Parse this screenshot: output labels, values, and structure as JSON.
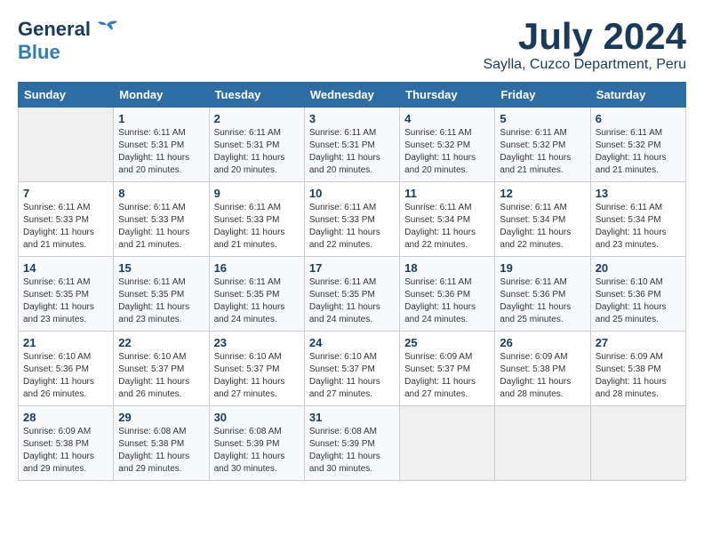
{
  "header": {
    "logo_general": "General",
    "logo_blue": "Blue",
    "month_title": "July 2024",
    "subtitle": "Saylla, Cuzco Department, Peru"
  },
  "weekdays": [
    "Sunday",
    "Monday",
    "Tuesday",
    "Wednesday",
    "Thursday",
    "Friday",
    "Saturday"
  ],
  "weeks": [
    [
      {
        "day": "",
        "sunrise": "",
        "sunset": "",
        "daylight": ""
      },
      {
        "day": "1",
        "sunrise": "Sunrise: 6:11 AM",
        "sunset": "Sunset: 5:31 PM",
        "daylight": "Daylight: 11 hours and 20 minutes."
      },
      {
        "day": "2",
        "sunrise": "Sunrise: 6:11 AM",
        "sunset": "Sunset: 5:31 PM",
        "daylight": "Daylight: 11 hours and 20 minutes."
      },
      {
        "day": "3",
        "sunrise": "Sunrise: 6:11 AM",
        "sunset": "Sunset: 5:31 PM",
        "daylight": "Daylight: 11 hours and 20 minutes."
      },
      {
        "day": "4",
        "sunrise": "Sunrise: 6:11 AM",
        "sunset": "Sunset: 5:32 PM",
        "daylight": "Daylight: 11 hours and 20 minutes."
      },
      {
        "day": "5",
        "sunrise": "Sunrise: 6:11 AM",
        "sunset": "Sunset: 5:32 PM",
        "daylight": "Daylight: 11 hours and 21 minutes."
      },
      {
        "day": "6",
        "sunrise": "Sunrise: 6:11 AM",
        "sunset": "Sunset: 5:32 PM",
        "daylight": "Daylight: 11 hours and 21 minutes."
      }
    ],
    [
      {
        "day": "7",
        "sunrise": "Sunrise: 6:11 AM",
        "sunset": "Sunset: 5:33 PM",
        "daylight": "Daylight: 11 hours and 21 minutes."
      },
      {
        "day": "8",
        "sunrise": "Sunrise: 6:11 AM",
        "sunset": "Sunset: 5:33 PM",
        "daylight": "Daylight: 11 hours and 21 minutes."
      },
      {
        "day": "9",
        "sunrise": "Sunrise: 6:11 AM",
        "sunset": "Sunset: 5:33 PM",
        "daylight": "Daylight: 11 hours and 21 minutes."
      },
      {
        "day": "10",
        "sunrise": "Sunrise: 6:11 AM",
        "sunset": "Sunset: 5:33 PM",
        "daylight": "Daylight: 11 hours and 22 minutes."
      },
      {
        "day": "11",
        "sunrise": "Sunrise: 6:11 AM",
        "sunset": "Sunset: 5:34 PM",
        "daylight": "Daylight: 11 hours and 22 minutes."
      },
      {
        "day": "12",
        "sunrise": "Sunrise: 6:11 AM",
        "sunset": "Sunset: 5:34 PM",
        "daylight": "Daylight: 11 hours and 22 minutes."
      },
      {
        "day": "13",
        "sunrise": "Sunrise: 6:11 AM",
        "sunset": "Sunset: 5:34 PM",
        "daylight": "Daylight: 11 hours and 23 minutes."
      }
    ],
    [
      {
        "day": "14",
        "sunrise": "Sunrise: 6:11 AM",
        "sunset": "Sunset: 5:35 PM",
        "daylight": "Daylight: 11 hours and 23 minutes."
      },
      {
        "day": "15",
        "sunrise": "Sunrise: 6:11 AM",
        "sunset": "Sunset: 5:35 PM",
        "daylight": "Daylight: 11 hours and 23 minutes."
      },
      {
        "day": "16",
        "sunrise": "Sunrise: 6:11 AM",
        "sunset": "Sunset: 5:35 PM",
        "daylight": "Daylight: 11 hours and 24 minutes."
      },
      {
        "day": "17",
        "sunrise": "Sunrise: 6:11 AM",
        "sunset": "Sunset: 5:35 PM",
        "daylight": "Daylight: 11 hours and 24 minutes."
      },
      {
        "day": "18",
        "sunrise": "Sunrise: 6:11 AM",
        "sunset": "Sunset: 5:36 PM",
        "daylight": "Daylight: 11 hours and 24 minutes."
      },
      {
        "day": "19",
        "sunrise": "Sunrise: 6:11 AM",
        "sunset": "Sunset: 5:36 PM",
        "daylight": "Daylight: 11 hours and 25 minutes."
      },
      {
        "day": "20",
        "sunrise": "Sunrise: 6:10 AM",
        "sunset": "Sunset: 5:36 PM",
        "daylight": "Daylight: 11 hours and 25 minutes."
      }
    ],
    [
      {
        "day": "21",
        "sunrise": "Sunrise: 6:10 AM",
        "sunset": "Sunset: 5:36 PM",
        "daylight": "Daylight: 11 hours and 26 minutes."
      },
      {
        "day": "22",
        "sunrise": "Sunrise: 6:10 AM",
        "sunset": "Sunset: 5:37 PM",
        "daylight": "Daylight: 11 hours and 26 minutes."
      },
      {
        "day": "23",
        "sunrise": "Sunrise: 6:10 AM",
        "sunset": "Sunset: 5:37 PM",
        "daylight": "Daylight: 11 hours and 27 minutes."
      },
      {
        "day": "24",
        "sunrise": "Sunrise: 6:10 AM",
        "sunset": "Sunset: 5:37 PM",
        "daylight": "Daylight: 11 hours and 27 minutes."
      },
      {
        "day": "25",
        "sunrise": "Sunrise: 6:09 AM",
        "sunset": "Sunset: 5:37 PM",
        "daylight": "Daylight: 11 hours and 27 minutes."
      },
      {
        "day": "26",
        "sunrise": "Sunrise: 6:09 AM",
        "sunset": "Sunset: 5:38 PM",
        "daylight": "Daylight: 11 hours and 28 minutes."
      },
      {
        "day": "27",
        "sunrise": "Sunrise: 6:09 AM",
        "sunset": "Sunset: 5:38 PM",
        "daylight": "Daylight: 11 hours and 28 minutes."
      }
    ],
    [
      {
        "day": "28",
        "sunrise": "Sunrise: 6:09 AM",
        "sunset": "Sunset: 5:38 PM",
        "daylight": "Daylight: 11 hours and 29 minutes."
      },
      {
        "day": "29",
        "sunrise": "Sunrise: 6:08 AM",
        "sunset": "Sunset: 5:38 PM",
        "daylight": "Daylight: 11 hours and 29 minutes."
      },
      {
        "day": "30",
        "sunrise": "Sunrise: 6:08 AM",
        "sunset": "Sunset: 5:39 PM",
        "daylight": "Daylight: 11 hours and 30 minutes."
      },
      {
        "day": "31",
        "sunrise": "Sunrise: 6:08 AM",
        "sunset": "Sunset: 5:39 PM",
        "daylight": "Daylight: 11 hours and 30 minutes."
      },
      {
        "day": "",
        "sunrise": "",
        "sunset": "",
        "daylight": ""
      },
      {
        "day": "",
        "sunrise": "",
        "sunset": "",
        "daylight": ""
      },
      {
        "day": "",
        "sunrise": "",
        "sunset": "",
        "daylight": ""
      }
    ]
  ]
}
